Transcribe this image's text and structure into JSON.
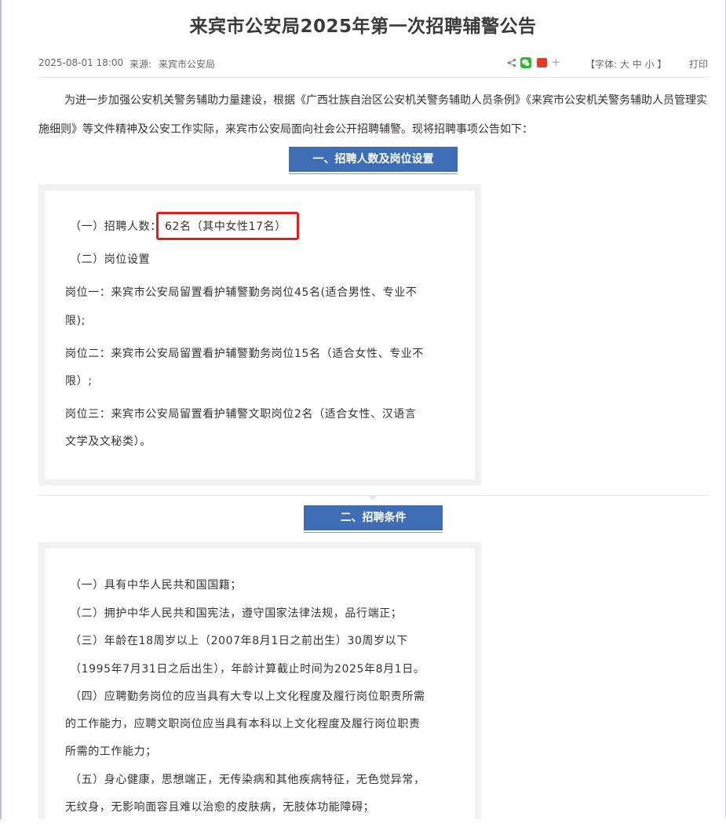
{
  "article": {
    "title": "来宾市公安局2025年第一次招聘辅警公告",
    "date": "2025-08-01 18:00",
    "source_label": "来源:",
    "source_value": "来宾市公安局",
    "font_label": "【字体:",
    "font_large": "大",
    "font_medium": "中",
    "font_small": "小",
    "font_close": "】",
    "print_label": "打印",
    "intro": "为进一步加强公安机关警务辅助力量建设，根据《广西壮族自治区公安机关警务辅助人员条例》《来宾市公安机关警务辅助人员管理实施细则》等文件精神及公安工作实际，来宾市公安局面向社会公开招聘辅警。现将招聘事项公告如下："
  },
  "share": {
    "icons": [
      "share-icon",
      "wechat-icon",
      "weibo-icon",
      "plus-icon"
    ],
    "wechat_color": "#2eb82e",
    "weibo_color": "#e33b2c"
  },
  "section1": {
    "heading": "一、招聘人数及岗位设置",
    "lines": [
      "（一）招聘人数：",
      "62名（其中女性17名）",
      "（二）岗位设置",
      "岗位一：来宾市公安局留置看护辅警勤务岗位45名(适合男性、专业不",
      "限);",
      "岗位二：来宾市公安局留置看护辅警勤务岗位15名（适合女性、专业不",
      "限）;",
      "岗位三：来宾市公安局留置看护辅警文职岗位2名（适合女性、汉语言",
      "文学及文秘类）。"
    ]
  },
  "section2": {
    "heading": "二、招聘条件",
    "lines": [
      "（一）具有中华人民共和国国籍；",
      "（二）拥护中华人民共和国宪法，遵守国家法律法规，品行端正；",
      "（三）年龄在18周岁以上（2007年8月1日之前出生）30周岁以下",
      "（1995年7月31日之后出生），年龄计算截止时间为2025年8月1日。",
      "（四）应聘勤务岗位的应当具有大专以上文化程度及履行岗位职责所需",
      "的工作能力，应聘文职岗位应当具有本科以上文化程度及履行岗位职责",
      "所需的工作能力；",
      "（五）身心健康，思想端正，无传染病和其他疾病特征，无色觉异常，",
      "无纹身，无影响面容且难以治愈的皮肤病，无肢体功能障碍；"
    ]
  },
  "colors": {
    "section_tag": "#3e6db4",
    "highlight": "#e21f1f",
    "box_border": "#a9a3d6"
  }
}
